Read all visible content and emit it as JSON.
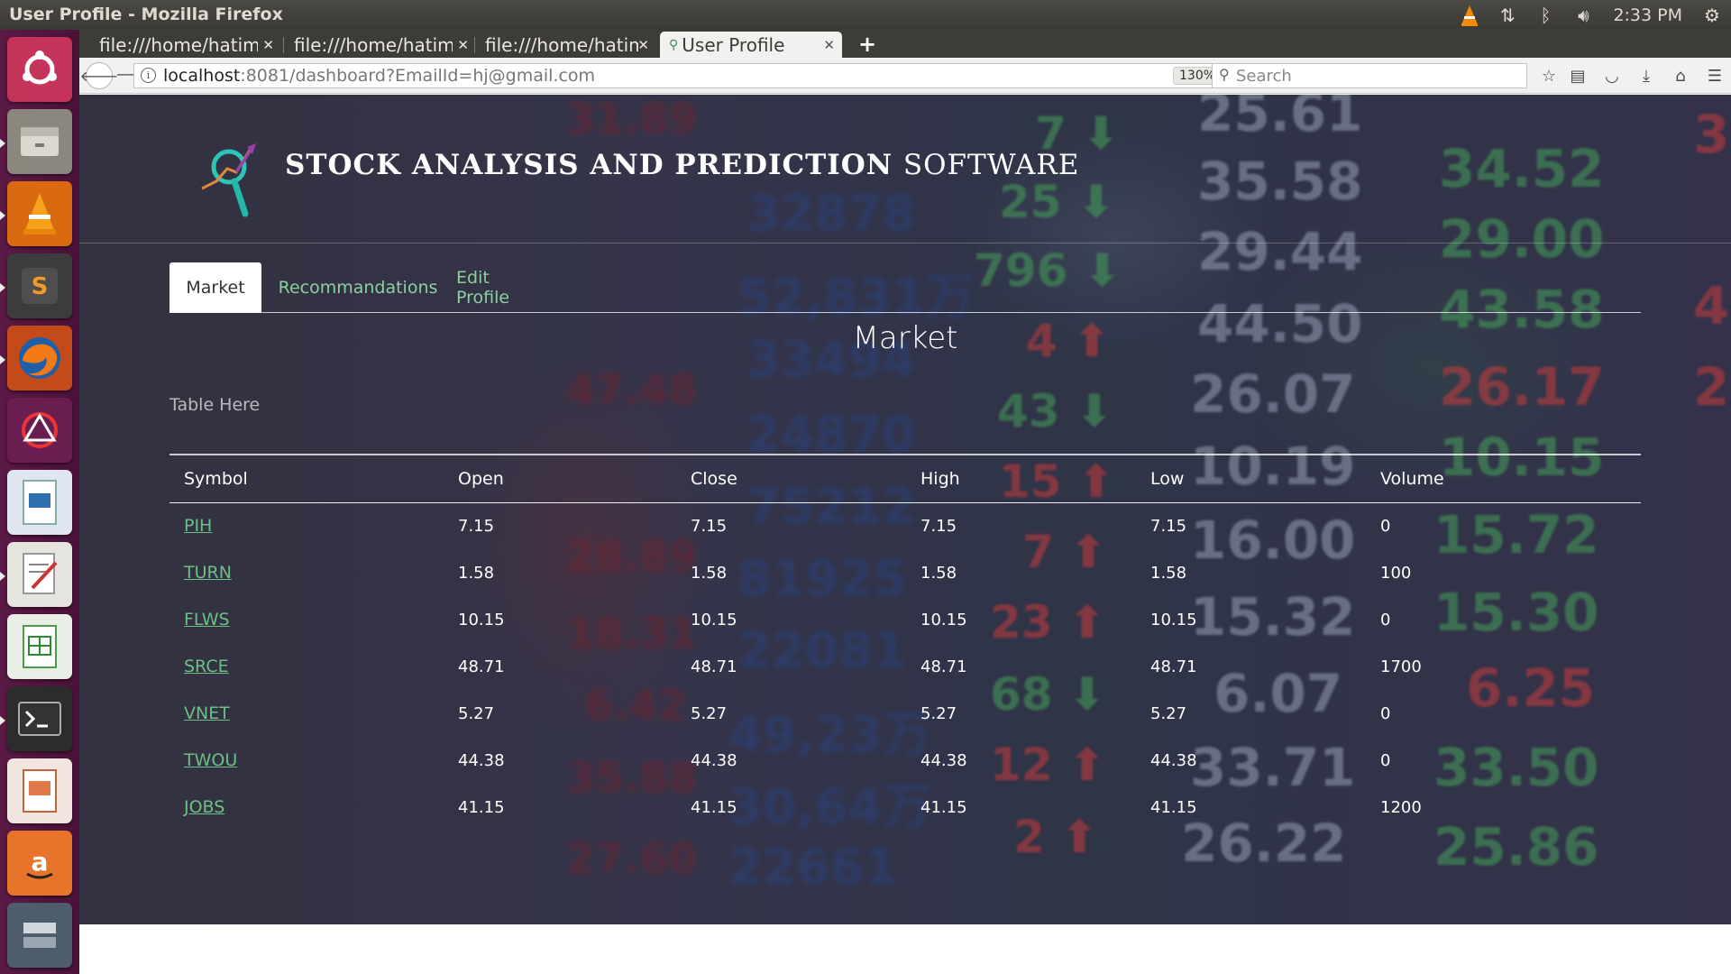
{
  "os": {
    "window_title": "User Profile - Mozilla Firefox",
    "clock": "2:33 PM",
    "tray_icons": [
      "vlc-icon",
      "network-icon",
      "bluetooth-icon",
      "volume-icon",
      "settings-icon"
    ],
    "launcher_items": [
      "ubuntu-dash",
      "files",
      "vlc",
      "sublime-text",
      "firefox",
      "settings-web",
      "libreoffice-impress-viewer",
      "text-editor",
      "libreoffice-calc",
      "terminal",
      "libreoffice-impress",
      "amazon",
      "more-apps"
    ]
  },
  "browser": {
    "tabs": [
      {
        "label": "file:///home/hatim/",
        "active": false
      },
      {
        "label": "file:///home/hatim/",
        "active": false
      },
      {
        "label": "file:///home/hatim/",
        "active": false
      },
      {
        "label": "User Profile",
        "active": true
      }
    ],
    "url_host": "localhost",
    "url_rest": ":8081/dashboard?EmailId=hj@gmail.com",
    "zoom": "130%",
    "search_placeholder": "Search"
  },
  "page": {
    "title_bold": "STOCK ANALYSIS AND PREDICTION",
    "title_thin": "SOFTWARE",
    "nav_tabs": [
      {
        "label": "Market",
        "active": true
      },
      {
        "label": "Recommandations",
        "active": false
      },
      {
        "label": "Edit Profile",
        "active": false
      }
    ],
    "heading": "Market",
    "table_caption": "Table Here",
    "table": {
      "columns": [
        "Symbol",
        "Open",
        "Close",
        "High",
        "Low",
        "Volume"
      ],
      "rows": [
        [
          "PIH",
          "7.15",
          "7.15",
          "7.15",
          "7.15",
          "0"
        ],
        [
          "TURN",
          "1.58",
          "1.58",
          "1.58",
          "1.58",
          "100"
        ],
        [
          "FLWS",
          "10.15",
          "10.15",
          "10.15",
          "10.15",
          "0"
        ],
        [
          "SRCE",
          "48.71",
          "48.71",
          "48.71",
          "48.71",
          "1700"
        ],
        [
          "VNET",
          "5.27",
          "5.27",
          "5.27",
          "5.27",
          "0"
        ],
        [
          "TWOU",
          "44.38",
          "44.38",
          "44.38",
          "44.38",
          "0"
        ],
        [
          "JOBS",
          "41.15",
          "41.15",
          "41.15",
          "41.15",
          "1200"
        ]
      ]
    }
  },
  "colors": {
    "link_green": "#6cbf86",
    "tab_green": "#8ad0a0",
    "background_dark": "#33324a",
    "launcher_purple": "#5b1a46"
  }
}
